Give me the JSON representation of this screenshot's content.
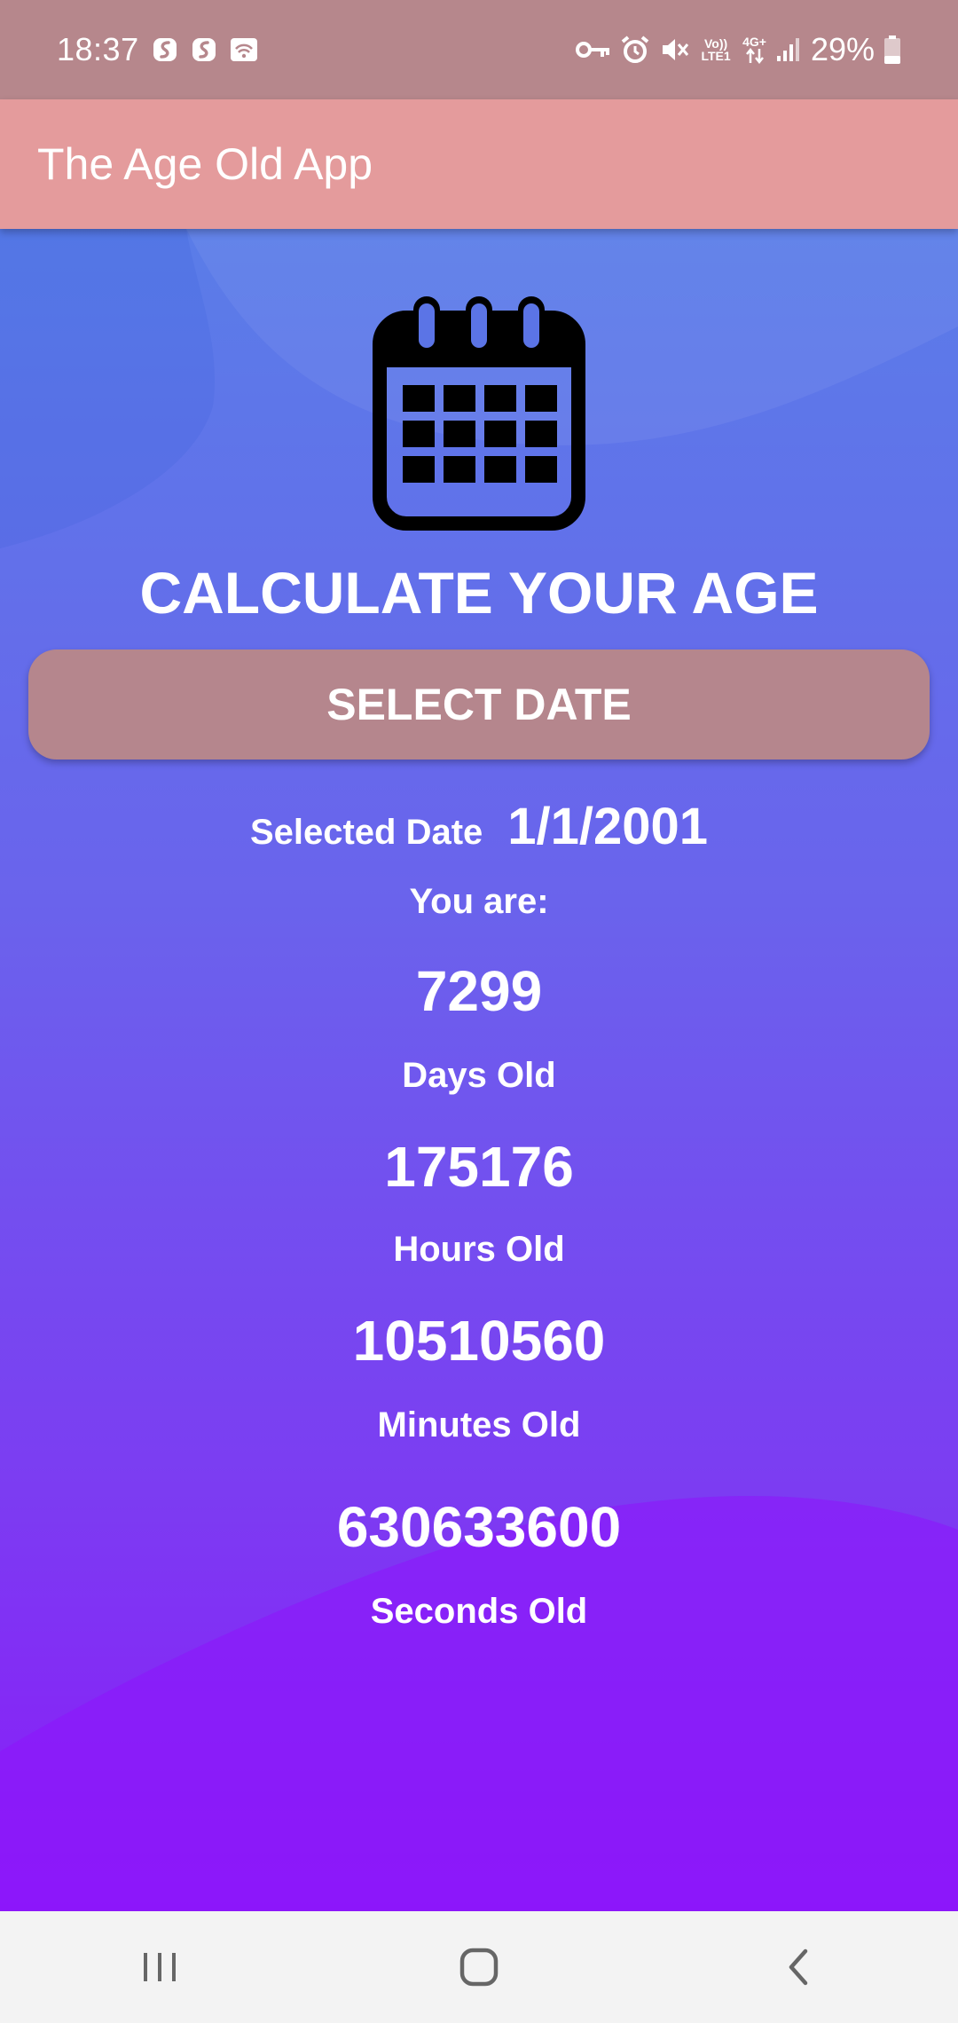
{
  "status_bar": {
    "time": "18:37",
    "volte_label": "Vo)) LTE1",
    "network_label": "4G+",
    "battery_percent": "29%",
    "icons": [
      "s-app-icon",
      "s-app-icon",
      "cast-icon",
      "vpn-key-icon",
      "alarm-icon",
      "mute-icon",
      "volte-icon",
      "data-arrows-icon",
      "signal-icon",
      "battery-icon"
    ]
  },
  "app_bar": {
    "title": "The Age Old App",
    "background": "#e49b9c"
  },
  "main": {
    "icon": "calendar-icon",
    "headline": "CALCULATE YOUR AGE",
    "select_button_label": "SELECT DATE",
    "button_color": "#b5868d",
    "selected_label": "Selected Date",
    "selected_value": "1/1/2001",
    "you_are_label": "You are:",
    "days_value": "7299",
    "days_label": "Days Old",
    "hours_value": "175176",
    "hours_label": "Hours Old",
    "minutes_value": "10510560",
    "minutes_label": "Minutes Old",
    "seconds_value": "630633600",
    "seconds_label": "Seconds Old",
    "gradient_top": "#5a7de8",
    "gradient_bottom": "#8a1af8"
  },
  "nav_bar": {
    "buttons": [
      "recent-apps-icon",
      "home-icon",
      "back-icon"
    ]
  }
}
